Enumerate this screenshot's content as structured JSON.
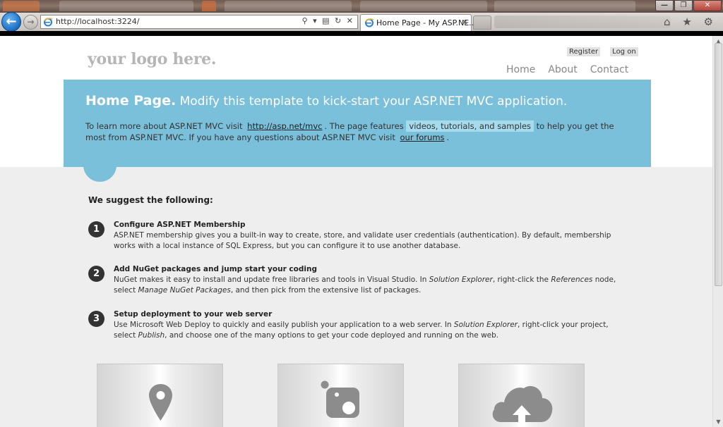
{
  "browser": {
    "address": "http://localhost:3224/",
    "tab_title": "Home Page - My ASP.NE...",
    "back_glyph": "←",
    "forward_glyph": "→",
    "address_icons": "⚲ ▾ ▤ ↻ ✕",
    "tab_close": "✕",
    "tool_icons": "⌂ ★ ⚙",
    "window_buttons": {
      "minimize": "—",
      "restore": "❐",
      "close": "✕"
    }
  },
  "site": {
    "logo": "your logo here.",
    "register_label": "Register",
    "login_label": "Log on",
    "nav": [
      "Home",
      "About",
      "Contact"
    ]
  },
  "featured": {
    "title_strong": "Home Page.",
    "title_rest": " Modify this template to kick-start your ASP.NET MVC application.",
    "text_1": "To learn more about ASP.NET MVC visit ",
    "link_mvc": "http://asp.net/mvc",
    "text_2": ". The page features ",
    "highlight": "videos, tutorials, and samples",
    "text_3": " to help you get the most from ASP.NET MVC. If you have any questions about ASP.NET MVC visit ",
    "link_forums": "our forums",
    "text_4": "."
  },
  "suggest_heading": "We suggest the following:",
  "steps": [
    {
      "number": "1",
      "title": "Configure ASP.NET Membership",
      "desc": "ASP.NET membership gives you a built-in way to create, store, and validate user credentials (authentication). By default, membership works with a local instance of SQL Express, but you can configure it to use another database."
    },
    {
      "number": "2",
      "title": "Add NuGet packages and jump start your coding",
      "desc_1": "NuGet makes it easy to install and update free libraries and tools in Visual Studio. In ",
      "desc_em1": "Solution Explorer",
      "desc_2": ", right-click the ",
      "desc_em2": "References",
      "desc_3": " node, select ",
      "desc_em3": "Manage NuGet Packages",
      "desc_4": ", and then pick from the extensive list of packages."
    },
    {
      "number": "3",
      "title": "Setup deployment to your web server",
      "desc_1": "Use Microsoft Web Deploy to quickly and easily publish your application to a web server. In ",
      "desc_em1": "Solution Explorer",
      "desc_2": ", right-click your project, select ",
      "desc_em2": "Publish",
      "desc_3": ", and choose one of the many options to get your code deployed and running on the web."
    }
  ],
  "cards": [
    {
      "icon": "location-pin-icon"
    },
    {
      "icon": "photo-icon"
    },
    {
      "icon": "cloud-upload-icon"
    }
  ],
  "colors": {
    "featured_bg": "#7ac0da",
    "highlight_bg": "#a6dbed",
    "gray_bg": "#efeeef",
    "logo": "#b5b5b5",
    "nav": "#888888"
  }
}
